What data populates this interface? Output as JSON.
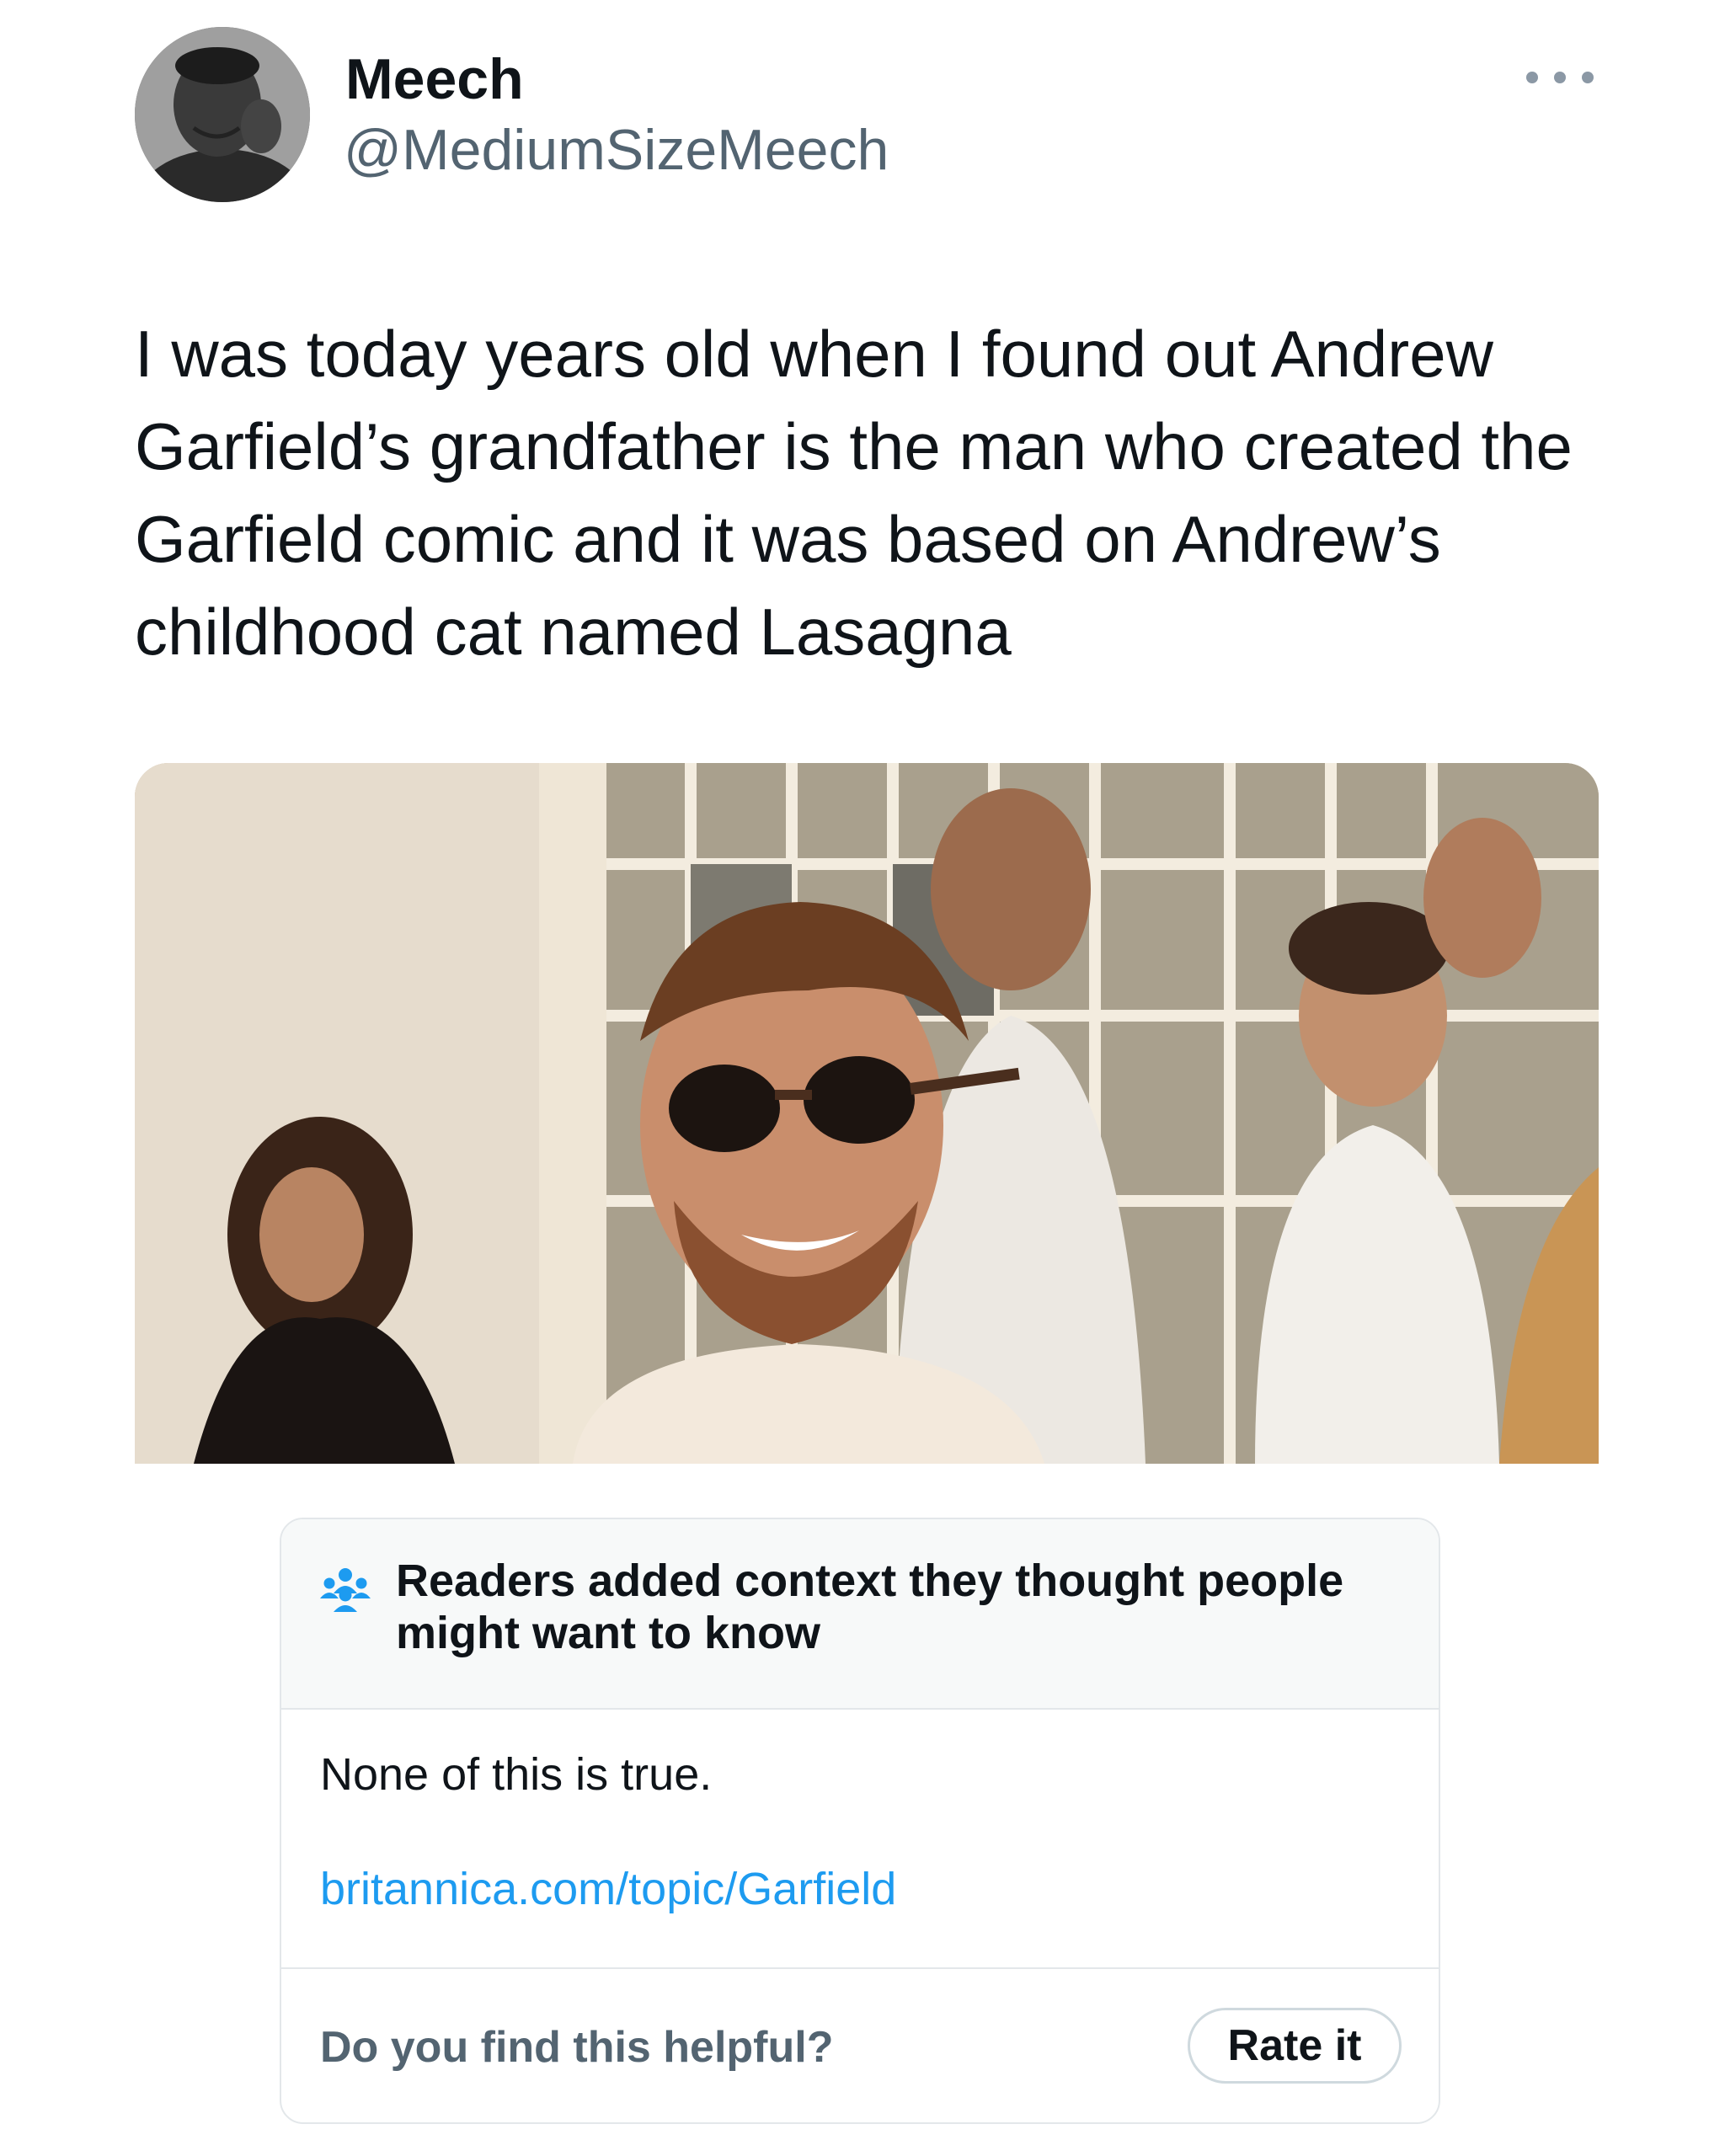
{
  "author": {
    "display_name": "Meech",
    "handle": "@MediumSizeMeech",
    "avatar": "profile-photo"
  },
  "tweet": {
    "text": "I was today years old when I found out Andrew Garfield’s grandfather is the man who created the Garfield comic and it was based on Andrew’s childhood cat named Lasagna",
    "media": "photo-smiling-man-in-sunglasses-with-group"
  },
  "community_note": {
    "title": "Readers added context they thought people might want to know",
    "body": "None of this is true.",
    "link": "britannica.com/topic/Garfield",
    "helpful_question": "Do you find this helpful?",
    "rate_button": "Rate it"
  },
  "colors": {
    "text_primary": "#0f1419",
    "text_secondary": "#536471",
    "link": "#1d9bf0",
    "note_header_bg": "#f7f9f9",
    "border": "#e3e7ea"
  },
  "icons": {
    "more": "more-dots-icon",
    "readers": "readers-group-icon"
  }
}
